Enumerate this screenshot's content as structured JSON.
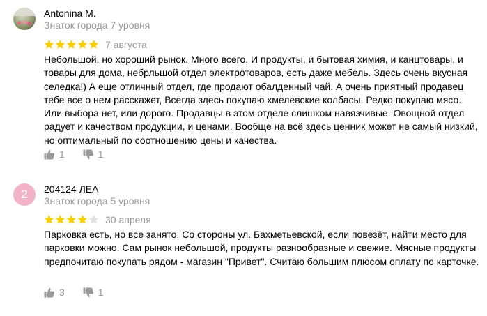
{
  "reviews": [
    {
      "author": "Antonina M.",
      "level": "Знаток города 7 уровня",
      "avatar": "user-photo",
      "rating": 5,
      "date": "7 августа",
      "text": "Небольшой, но хороший рынок. Много всего. И продукты, и бытовая химия, и канцтовары, и товары для дома, небрльшой отдел электротоваров, есть даже мебель. Здесь очень вкусная селедка!) А еще отличный отдел, где продают обалденный чай. А очень приятный продавец тебе все о нем расскажет, Всегда здесь покупаю хмелевские колбасы. Редко покупаю мясо. Или выбора нет, или дорого. Продавцы в этом отделе слишком навязчивые. Овощной отдел радует и качеством продукции, и ценами. Вообще на всё здесь ценник может не самый низкий, но оптимальный по соотношению цены и качества.",
      "likes": "1",
      "dislikes": "1"
    },
    {
      "author": "204124 ЛЕА",
      "level": "Знаток города 5 уровня",
      "avatar_letter": "2",
      "rating": 4,
      "date": "30 апреля",
      "text": "Парковка есть, но все занято. Со стороны ул. Бахметьевской, если повезёт, найти место для парковки можно. Сам рынок небольшой, продукты разнообразные и свежие. Мясные продукты предпочитаю покупать рядом - магазин \"Привет\". Считаю большим плюсом оплату по карточке.",
      "likes": "3",
      "dislikes": "1"
    }
  ],
  "colors": {
    "star_filled": "#FFCC00",
    "star_empty": "#E0E0E0",
    "secondary_text": "#999999",
    "avatar_letter_bg": "#F2B3C8",
    "icon": "#999999"
  },
  "icons": {
    "like": "thumbs-up-icon",
    "dislike": "thumbs-down-icon",
    "star": "star-icon"
  }
}
